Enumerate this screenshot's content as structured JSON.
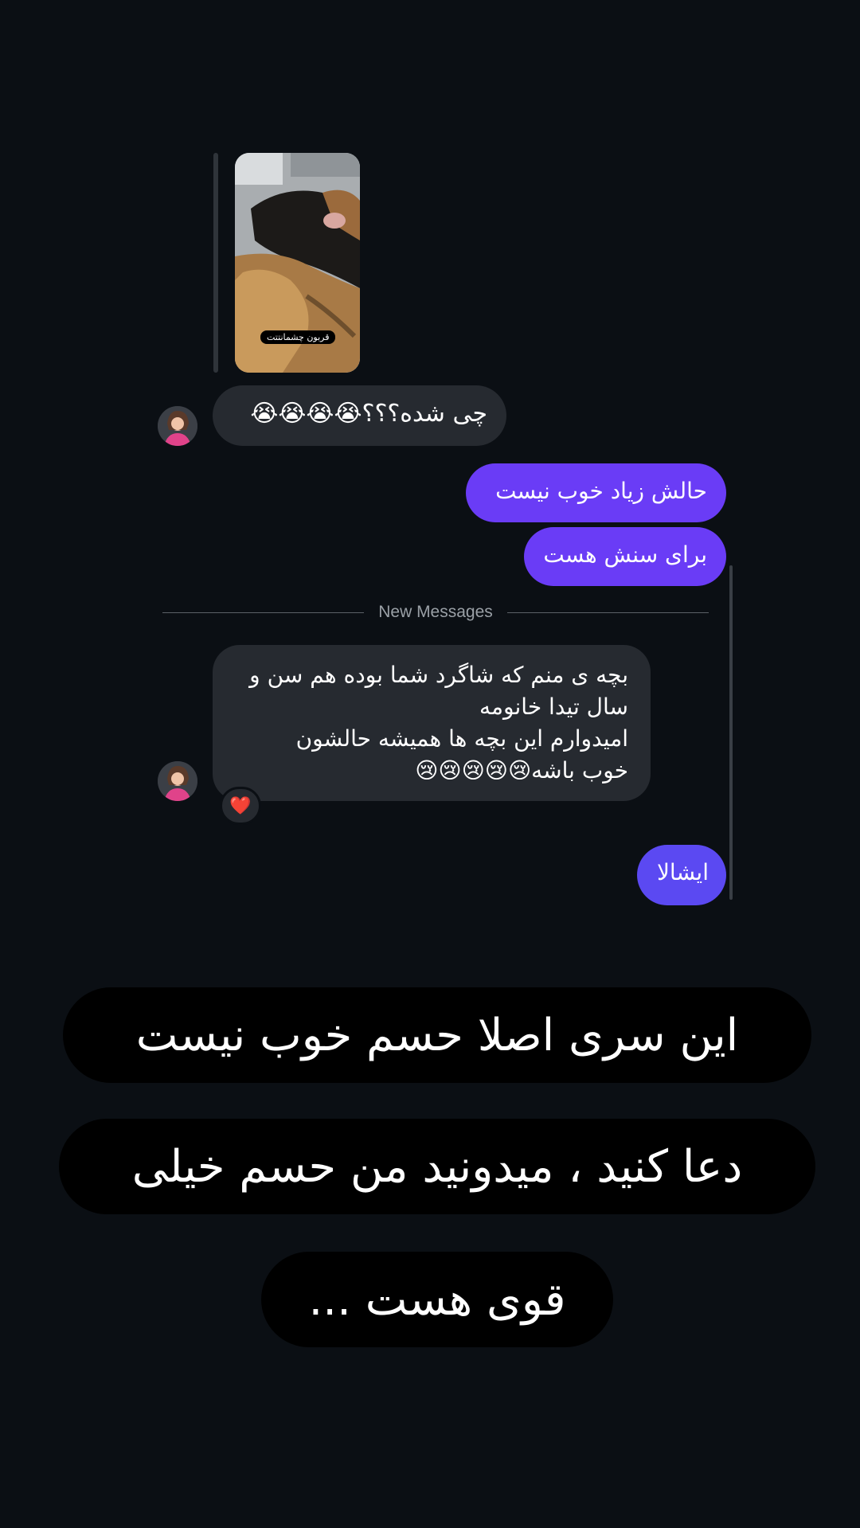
{
  "media": {
    "caption": "قربون چشمانتتت"
  },
  "messages": [
    {
      "direction": "incoming",
      "text": "چی شده؟؟؟😭😭😭😭"
    },
    {
      "direction": "outgoing",
      "text": "حالش زیاد خوب نیست"
    },
    {
      "direction": "outgoing",
      "text": "برای سنش هست"
    },
    {
      "direction": "incoming",
      "lines": [
        "بچه ی منم که شاگرد شما بوده هم سن و",
        "سال تیدا خانومه",
        "امیدوارم این بچه ها همیشه حالشون",
        "خوب باشه😢😢😢😢😢"
      ],
      "reaction": "❤️"
    },
    {
      "direction": "outgoing",
      "text": "ایشالا"
    }
  ],
  "divider": {
    "label": "New Messages"
  },
  "overlay_text": [
    "این سری اصلا حسم خوب نیست",
    "دعا کنید ، میدونید من حسم خیلی",
    "قوی هست ..."
  ],
  "colors": {
    "background": "#0b0f14",
    "incoming_bubble": "#262a30",
    "outgoing_bubble": "#6a3cf6",
    "outgoing_bubble_alt": "#5b49f2"
  }
}
